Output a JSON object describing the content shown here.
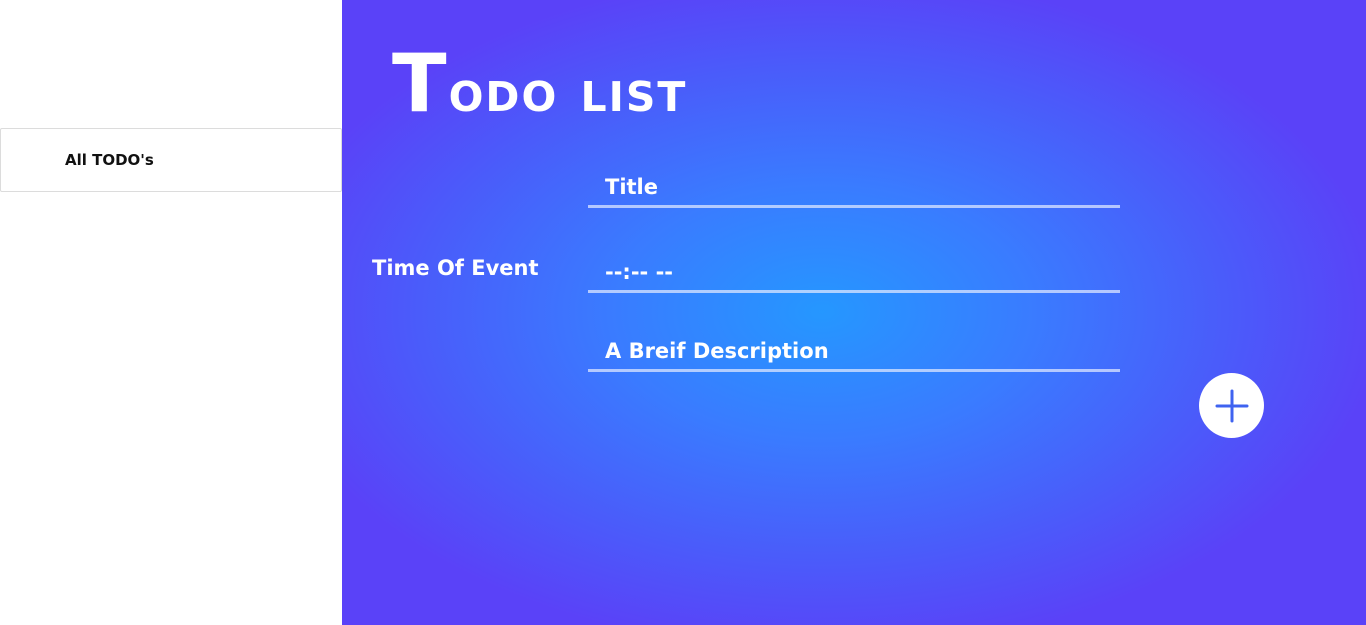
{
  "sidebar": {
    "items": [
      {
        "label": "All TODO's"
      }
    ]
  },
  "header": {
    "title_first_letter": "T",
    "title_rest": "odo list"
  },
  "form": {
    "title_field": {
      "placeholder": "Title",
      "value": ""
    },
    "time_field": {
      "label": "Time Of Event",
      "value": "--:-- --"
    },
    "description_field": {
      "placeholder": "A Breif Description",
      "value": ""
    },
    "add_button": {
      "icon": "plus-icon"
    }
  },
  "colors": {
    "gradient_center": "#2597ff",
    "gradient_edge": "#5a42f8",
    "sidebar_background": "#ffffff",
    "text_on_gradient": "#ffffff",
    "plus_icon": "#3f63f0"
  }
}
